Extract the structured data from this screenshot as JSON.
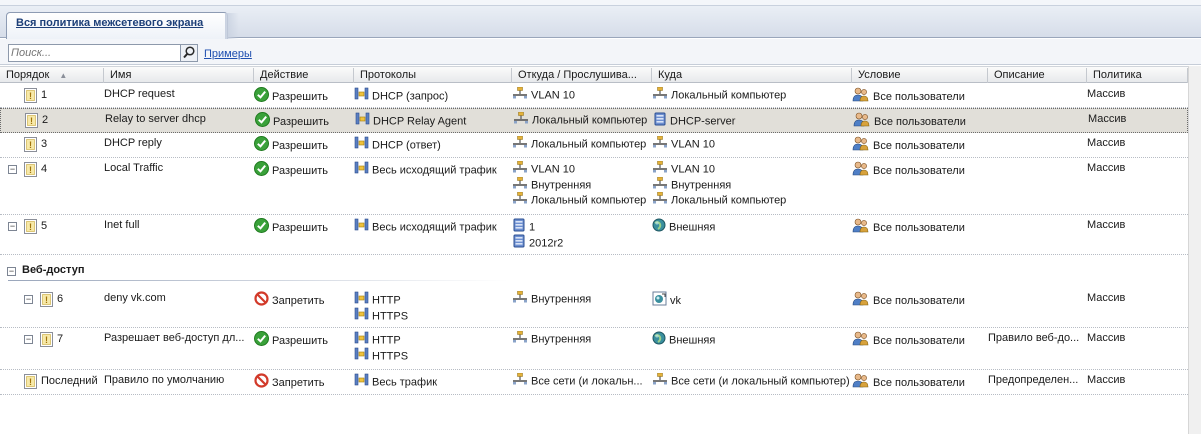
{
  "tab": {
    "title": "Вся политика межсетевого экрана"
  },
  "search": {
    "placeholder": "Поиск...",
    "examples_link": "Примеры"
  },
  "columns": [
    "Порядок",
    "Имя",
    "Действие",
    "Протоколы",
    "Откуда / Прослушива...",
    "Куда",
    "Условие",
    "Описание",
    "Политика"
  ],
  "rules": [
    {
      "order": "1",
      "name": "DHCP request",
      "action": "Разрешить",
      "action_type": "allow",
      "protocols": [
        "DHCP (запрос)"
      ],
      "from": [
        {
          "icon": "network",
          "text": "VLAN 10"
        }
      ],
      "to": [
        {
          "icon": "network",
          "text": "Локальный компьютер"
        }
      ],
      "condition": "Все пользователи",
      "description": "",
      "policy": "Массив"
    },
    {
      "order": "2",
      "name": "Relay to server dhcp",
      "action": "Разрешить",
      "action_type": "allow",
      "protocols": [
        "DHCP Relay Agent"
      ],
      "from": [
        {
          "icon": "network",
          "text": "Локальный компьютер"
        }
      ],
      "to": [
        {
          "icon": "server",
          "text": "DHCP-server"
        }
      ],
      "condition": "Все пользователи",
      "description": "",
      "policy": "Массив",
      "selected": true
    },
    {
      "order": "3",
      "name": "DHCP reply",
      "action": "Разрешить",
      "action_type": "allow",
      "protocols": [
        "DHCP (ответ)"
      ],
      "from": [
        {
          "icon": "network",
          "text": "Локальный компьютер"
        }
      ],
      "to": [
        {
          "icon": "network",
          "text": "VLAN 10"
        }
      ],
      "condition": "Все пользователи",
      "description": "",
      "policy": "Массив"
    },
    {
      "order": "4",
      "name": "Local Traffic",
      "action": "Разрешить",
      "action_type": "allow",
      "protocols": [
        "Весь исходящий трафик"
      ],
      "from": [
        {
          "icon": "network",
          "text": "VLAN 10"
        },
        {
          "icon": "network",
          "text": "Внутренняя"
        },
        {
          "icon": "network",
          "text": "Локальный компьютер"
        }
      ],
      "to": [
        {
          "icon": "network",
          "text": "VLAN 10"
        },
        {
          "icon": "network",
          "text": "Внутренняя"
        },
        {
          "icon": "network",
          "text": "Локальный компьютер"
        }
      ],
      "condition": "Все пользователи",
      "description": "",
      "policy": "Массив",
      "expander": true
    },
    {
      "order": "5",
      "name": "Inet full",
      "action": "Разрешить",
      "action_type": "allow",
      "protocols": [
        "Весь исходящий трафик"
      ],
      "from": [
        {
          "icon": "server",
          "text": "1"
        },
        {
          "icon": "server",
          "text": "2012r2"
        }
      ],
      "to": [
        {
          "icon": "globe",
          "text": "Внешняя"
        }
      ],
      "condition": "Все пользователи",
      "description": "",
      "policy": "Массив",
      "expander": true
    }
  ],
  "group": {
    "title": "Веб-доступ"
  },
  "group_rules": [
    {
      "order": "6",
      "name": "deny vk.com",
      "action": "Запретить",
      "action_type": "deny",
      "protocols": [
        "HTTP",
        "HTTPS"
      ],
      "from": [
        {
          "icon": "network",
          "text": "Внутренняя"
        }
      ],
      "to": [
        {
          "icon": "url",
          "text": "vk"
        }
      ],
      "condition": "Все пользователи",
      "description": "",
      "policy": "Массив"
    },
    {
      "order": "7",
      "name": "Разрешает веб-доступ дл...",
      "action": "Разрешить",
      "action_type": "allow",
      "protocols": [
        "HTTP",
        "HTTPS"
      ],
      "from": [
        {
          "icon": "network",
          "text": "Внутренняя"
        }
      ],
      "to": [
        {
          "icon": "globe",
          "text": "Внешняя"
        }
      ],
      "condition": "Все пользователи",
      "description": "Правило веб-до...",
      "policy": "Массив"
    }
  ],
  "last_rule": {
    "order": "Последний",
    "name": "Правило по умолчанию",
    "action": "Запретить",
    "action_type": "deny",
    "protocols": [
      "Весь трафик"
    ],
    "from": [
      {
        "icon": "network",
        "text": "Все сети (и локальн..."
      }
    ],
    "to": [
      {
        "icon": "network",
        "text": "Все сети (и локальный компьютер)"
      }
    ],
    "condition": "Все пользователи",
    "description": "Предопределен...",
    "policy": "Массив"
  },
  "colors": {
    "allow": "#3aa13a",
    "deny": "#d23a2a",
    "selected_row": "#e1dfd9",
    "tab_text": "#1d3f78"
  }
}
